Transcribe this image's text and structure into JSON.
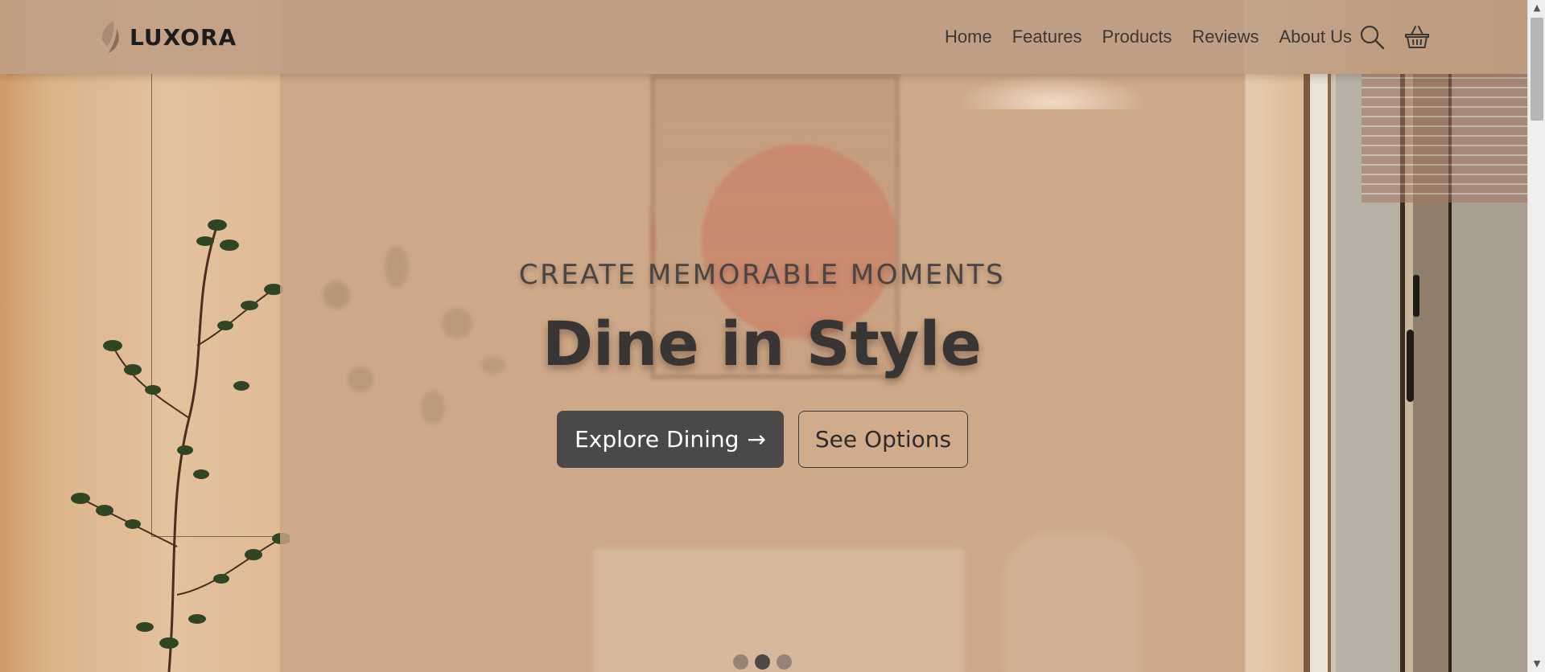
{
  "brand": {
    "name": "LUXORA"
  },
  "nav": {
    "links": [
      {
        "label": "Home"
      },
      {
        "label": "Features"
      },
      {
        "label": "Products"
      },
      {
        "label": "Reviews"
      },
      {
        "label": "About Us"
      }
    ],
    "icons": [
      "search-icon",
      "basket-icon"
    ]
  },
  "hero": {
    "subtitle": "CREATE MEMORABLE MOMENTS",
    "title": "Dine in Style",
    "primary_button": "Explore Dining",
    "primary_button_icon": "→",
    "secondary_button": "See Options",
    "carousel": {
      "slides": 3,
      "active_index": 1
    }
  },
  "colors": {
    "header_bg": "#be9e84",
    "primary_button_bg": "#4a4848",
    "text_dark": "#383534",
    "accent_tan": "#c8a686"
  },
  "scrollbar": {
    "up_glyph": "▲",
    "down_glyph": "▼"
  }
}
